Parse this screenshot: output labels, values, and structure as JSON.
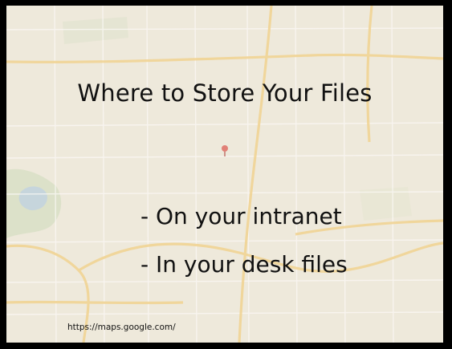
{
  "slide": {
    "title": "Where to Store Your Files",
    "bullets": [
      "- On your intranet",
      "- In your desk files"
    ],
    "source": "https://maps.google.com/"
  },
  "colors": {
    "background": "#000000",
    "map_base": "#ece6d6",
    "highway": "#f0c66a",
    "park": "#c9d8b4",
    "water": "#a8c4dc",
    "marker": "#d8453b"
  }
}
